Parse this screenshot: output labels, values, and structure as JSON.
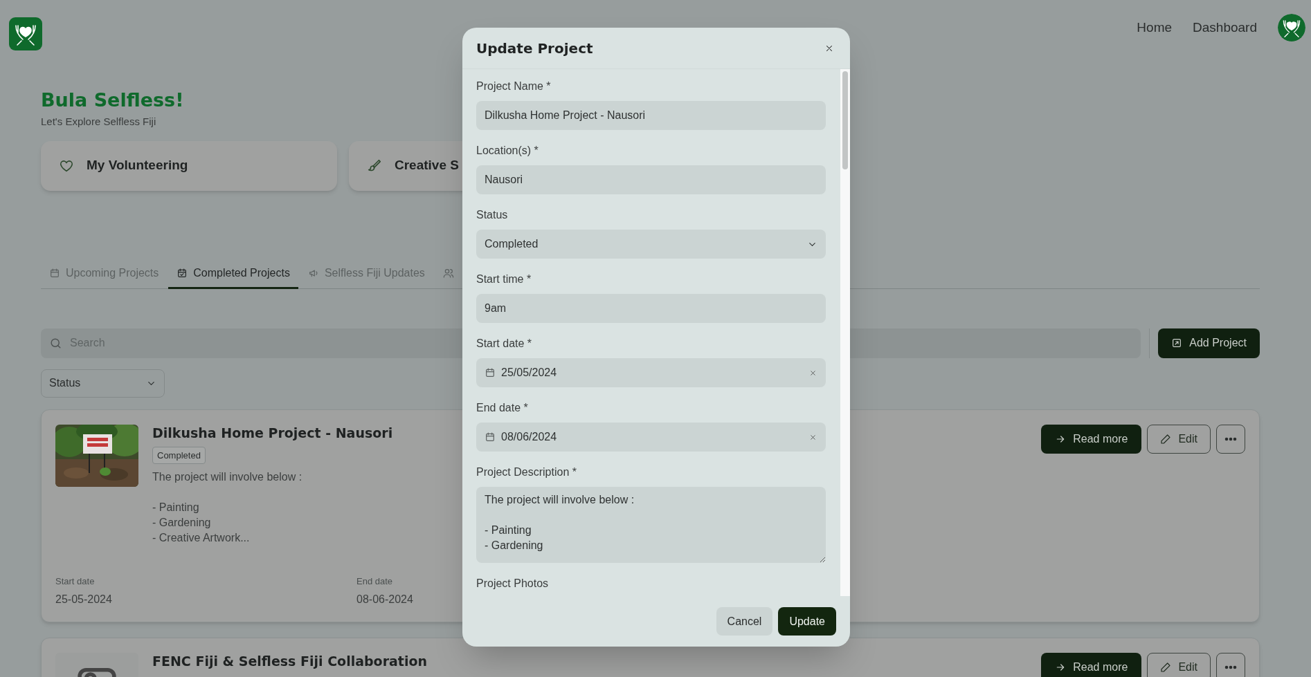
{
  "header": {
    "nav": [
      {
        "label": "Home"
      },
      {
        "label": "Dashboard"
      }
    ]
  },
  "greeting": {
    "title": "Bula Selfless!",
    "subtitle": "Let's Explore Selfless Fiji"
  },
  "feature_cards": [
    {
      "label": "My Volunteering"
    },
    {
      "label": "Creative S"
    }
  ],
  "tabs": [
    {
      "label": "Upcoming Projects",
      "selected": false
    },
    {
      "label": "Completed Projects",
      "selected": true
    },
    {
      "label": "Selfless Fiji Updates",
      "selected": false
    },
    {
      "selected": false
    }
  ],
  "search": {
    "placeholder": "Search"
  },
  "add_button": "Add Project",
  "status_filter": {
    "placeholder": "Status"
  },
  "projects": [
    {
      "title": "Dilkusha Home Project - Nausori",
      "status": "Completed",
      "description": "The project will involve below :\n\n- Painting\n- Gardening\n- Creative Artwork...",
      "start_label": "Start date",
      "start_date": "25-05-2024",
      "end_label": "End date",
      "end_date": "08-06-2024",
      "read_more": "Read more",
      "edit": "Edit"
    },
    {
      "title": "FENC Fiji & Selfless Fiji Collaboration",
      "kind": "placeholder",
      "read_more": "Read more",
      "edit": "Edit"
    }
  ],
  "modal": {
    "title": "Update Project",
    "fields": [
      {
        "kind": "text",
        "label": "Project Name *",
        "value": "Dilkusha Home Project - Nausori"
      },
      {
        "kind": "text",
        "label": "Location(s) *",
        "value": "Nausori"
      },
      {
        "kind": "select",
        "label": "Status",
        "value": "Completed"
      },
      {
        "kind": "text",
        "label": "Start time *",
        "value": "9am"
      },
      {
        "kind": "date",
        "label": "Start date *",
        "value": "25/05/2024"
      },
      {
        "kind": "date",
        "label": "End date *",
        "value": "08/06/2024"
      },
      {
        "kind": "textarea",
        "label": "Project Description *",
        "value": "The project will involve below :\n\n- Painting\n- Gardening"
      },
      {
        "kind": "section",
        "label": "Project Photos"
      }
    ],
    "cancel": "Cancel",
    "submit": "Update"
  }
}
